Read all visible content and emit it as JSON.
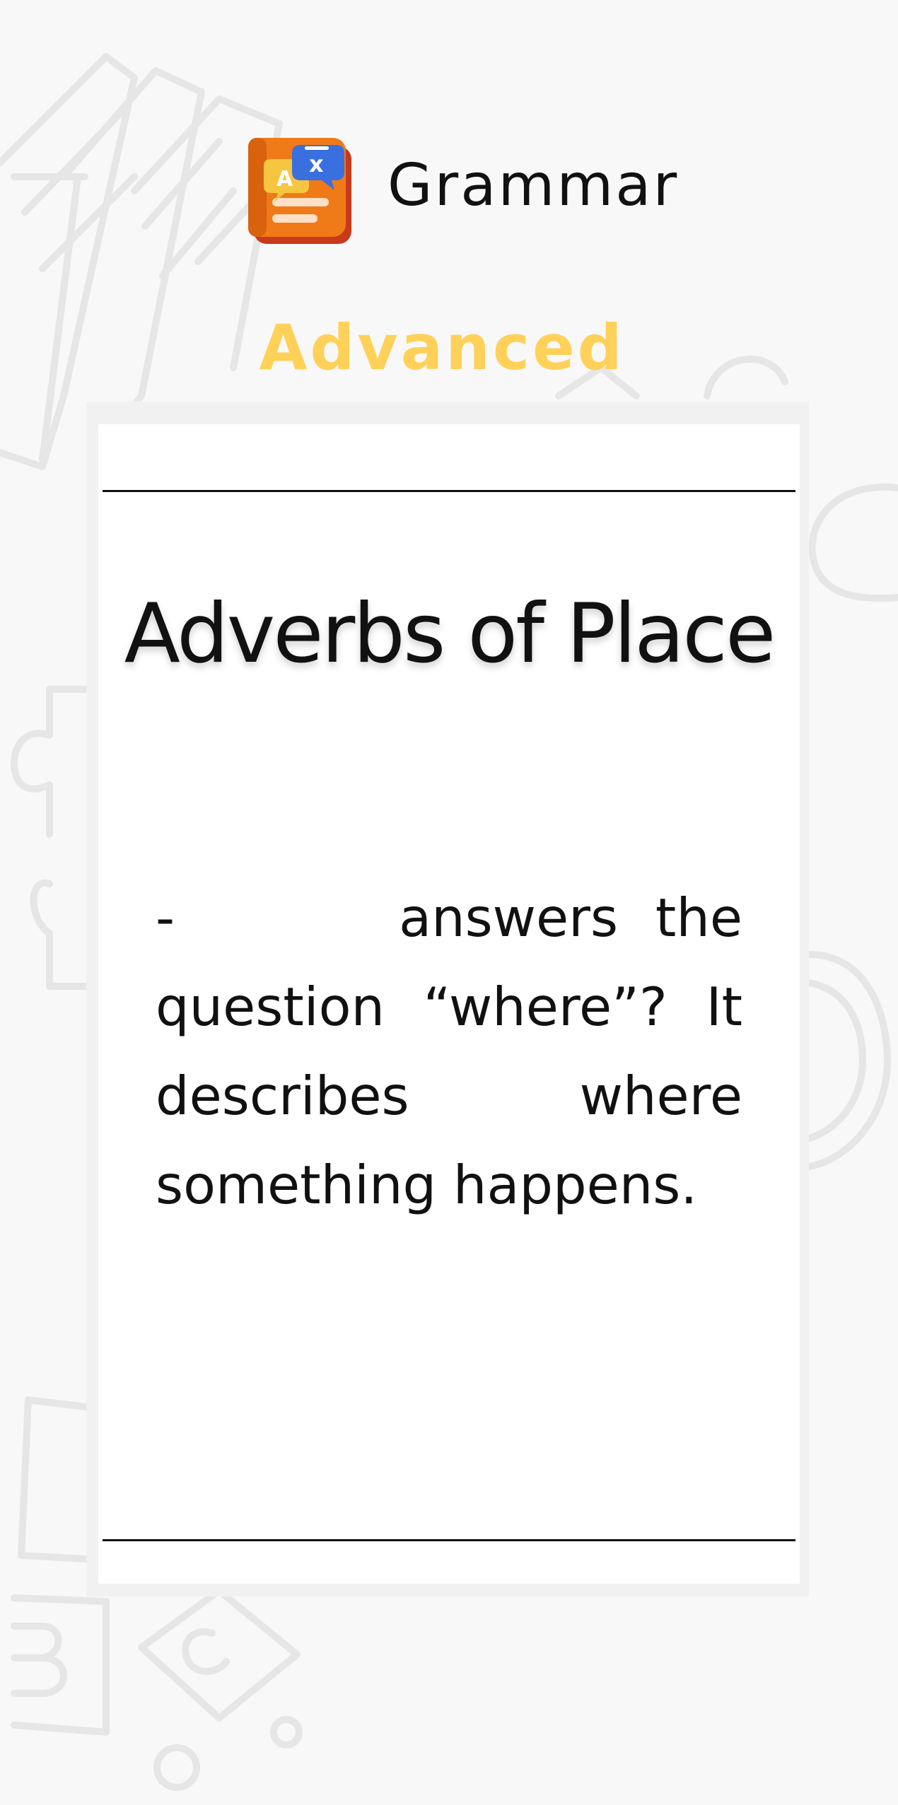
{
  "header": {
    "app_title": "Grammar",
    "level": "Advanced",
    "icon": "grammar-book-icon"
  },
  "lesson": {
    "title": "Adverbs of Place",
    "body": "-      answers the question “where”? It describes where something happens."
  },
  "colors": {
    "background": "#f8f8f8",
    "level_accent": "#ffd159",
    "icon_orange": "#f07a18",
    "text": "#111111"
  }
}
